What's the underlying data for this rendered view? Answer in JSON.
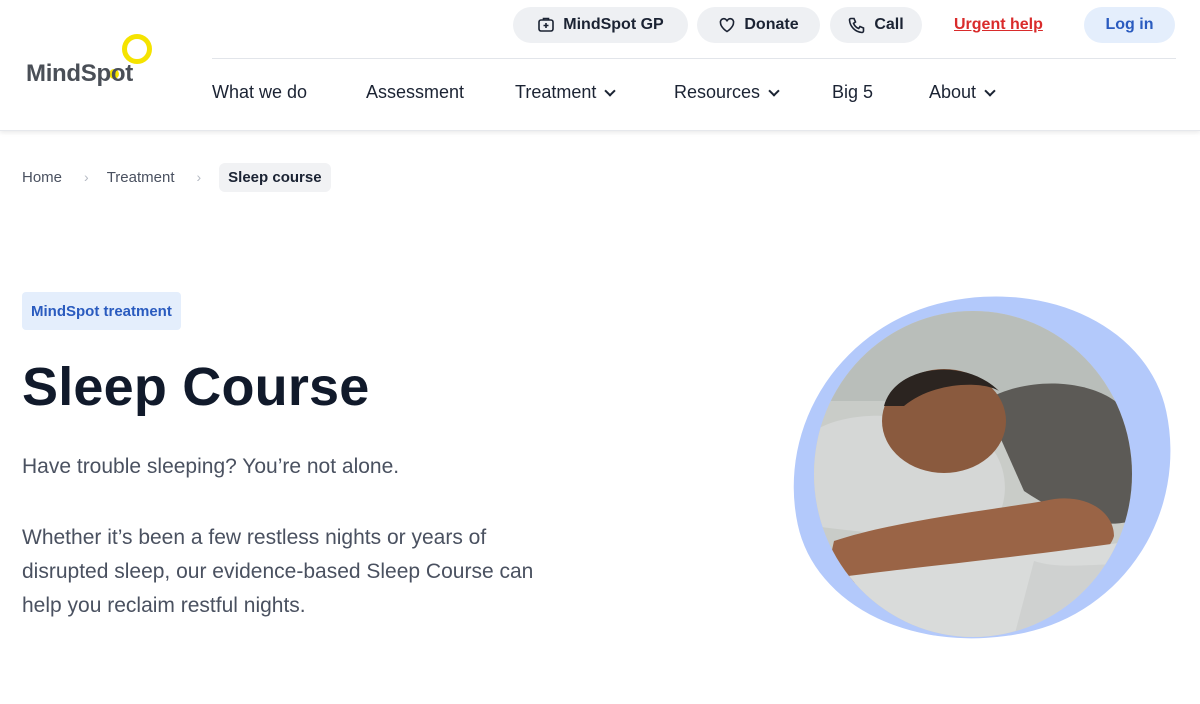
{
  "brand": {
    "logo_text": "MindSpot",
    "accent": "#f5e300"
  },
  "utility_nav": {
    "gp_label": "MindSpot GP",
    "donate_label": "Donate",
    "call_label": "Call",
    "urgent_label": "Urgent help",
    "login_label": "Log in"
  },
  "main_nav": {
    "items": [
      {
        "label": "What we do"
      },
      {
        "label": "Assessment"
      },
      {
        "label": "Treatment"
      },
      {
        "label": "Resources"
      },
      {
        "label": "Big 5"
      },
      {
        "label": "About"
      }
    ]
  },
  "breadcrumb": {
    "items": [
      {
        "label": "Home"
      },
      {
        "label": "Treatment"
      }
    ],
    "current": "Sleep course"
  },
  "hero": {
    "tag": "MindSpot treatment",
    "title": "Sleep Course",
    "lead": "Have trouble sleeping? You’re not alone.",
    "body": "Whether it’s been a few restless nights or years of disrupted sleep, our evidence-based Sleep Course can help you reclaim restful nights."
  },
  "colors": {
    "urgent": "#d92b2b",
    "link_blue": "#2a5bbf",
    "pill_bg": "#eef0f3",
    "blob": "#b3c9fb"
  }
}
